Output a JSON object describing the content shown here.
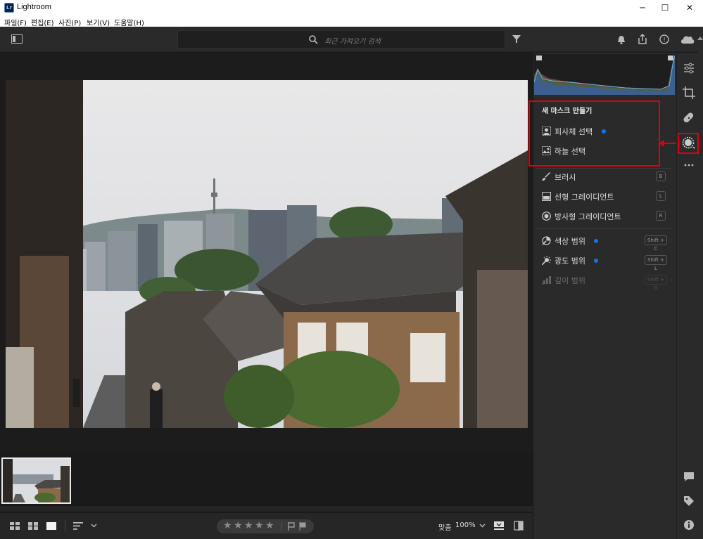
{
  "window": {
    "title": "Lightroom",
    "logo": "Lr",
    "controls": [
      "─",
      "☐",
      "✕"
    ]
  },
  "menu": [
    {
      "label": "파일(F)"
    },
    {
      "label": "편집(E)"
    },
    {
      "label": "사진(P)"
    },
    {
      "label": "보기(V)"
    },
    {
      "label": "도움말(H)"
    }
  ],
  "toolbar": {
    "search_placeholder": "최근 가져오기 검색",
    "icons": [
      "panel-toggle-icon",
      "search-icon",
      "filter-icon",
      "bell-icon",
      "share-icon",
      "help-icon",
      "cloud-icon"
    ]
  },
  "masking": {
    "header": "새 마스크 만들기",
    "items": [
      {
        "label": "피사체 선택",
        "icon": "person-icon",
        "dot": true,
        "shortcut": ""
      },
      {
        "label": "하늘 선택",
        "icon": "sky-icon",
        "dot": false,
        "shortcut": ""
      },
      {
        "label": "브러시",
        "icon": "brush-icon",
        "dot": false,
        "shortcut": "B"
      },
      {
        "label": "선형 그레이디언트",
        "icon": "linear-gradient-icon",
        "dot": false,
        "shortcut": "L"
      },
      {
        "label": "방사형 그레이디언트",
        "icon": "radial-gradient-icon",
        "dot": false,
        "shortcut": "R"
      },
      {
        "label": "색상 범위",
        "icon": "color-range-icon",
        "dot": true,
        "shortcut": "Shift + C"
      },
      {
        "label": "광도 범위",
        "icon": "luminance-range-icon",
        "dot": true,
        "shortcut": "Shift + L"
      },
      {
        "label": "깊이 범위",
        "icon": "depth-range-icon",
        "dot": false,
        "shortcut": "Shift + D",
        "disabled": true
      }
    ]
  },
  "bottombar": {
    "stars": [
      "★",
      "★",
      "★",
      "★",
      "★"
    ],
    "fit_label": "맞춤",
    "zoom": "100%"
  },
  "rail_icons": [
    "edit-sliders-icon",
    "crop-icon",
    "healing-icon",
    "masking-icon",
    "more-icon",
    "comment-icon",
    "tag-icon",
    "info-icon"
  ],
  "colors": {
    "accent": "#1473e6",
    "highlight_box": "#e0000b"
  }
}
